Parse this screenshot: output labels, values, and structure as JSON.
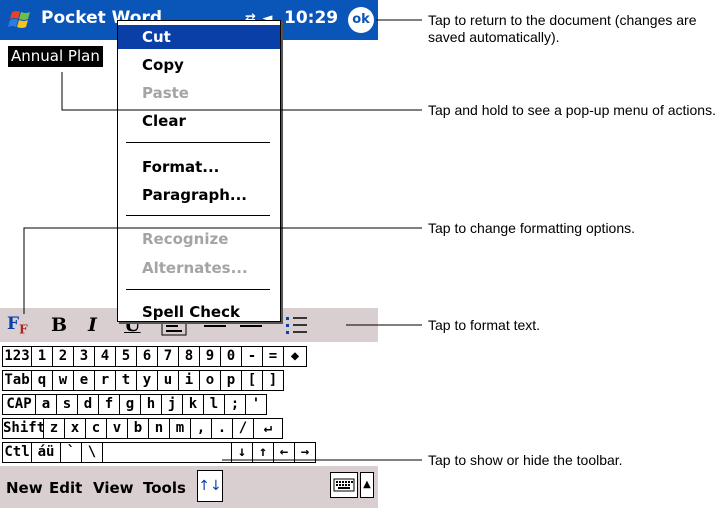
{
  "titlebar": {
    "app_title": "Pocket Word",
    "tray_icons": "⇄ ◄",
    "clock": "10:29",
    "ok_label": "ok"
  },
  "document": {
    "selected_text": "Annual Plan"
  },
  "context_menu": {
    "items": [
      {
        "label": "Cut",
        "state": "selected"
      },
      {
        "label": "Copy",
        "state": "enabled"
      },
      {
        "label": "Paste",
        "state": "disabled"
      },
      {
        "label": "Clear",
        "state": "enabled"
      },
      {
        "label": "Format...",
        "state": "enabled"
      },
      {
        "label": "Paragraph...",
        "state": "enabled"
      },
      {
        "label": "Recognize",
        "state": "disabled"
      },
      {
        "label": "Alternates...",
        "state": "disabled"
      },
      {
        "label": "Spell Check",
        "state": "enabled"
      }
    ]
  },
  "toolbar": {
    "format_icon": "font-format-icon",
    "bold": "B",
    "italic": "I",
    "underline": "U",
    "align_left_icon": "align-left-icon",
    "align_center_icon": "align-center-icon",
    "align_right_icon": "align-right-icon",
    "bullets_icon": "bullets-icon"
  },
  "keyboard": {
    "rows": [
      [
        "123",
        "1",
        "2",
        "3",
        "4",
        "5",
        "6",
        "7",
        "8",
        "9",
        "0",
        "-",
        "=",
        "◆"
      ],
      [
        "Tab",
        "q",
        "w",
        "e",
        "r",
        "t",
        "y",
        "u",
        "i",
        "o",
        "p",
        "[",
        "]"
      ],
      [
        "CAP",
        "a",
        "s",
        "d",
        "f",
        "g",
        "h",
        "j",
        "k",
        "l",
        ";",
        "'"
      ],
      [
        "Shift",
        "z",
        "x",
        "c",
        "v",
        "b",
        "n",
        "m",
        ",",
        ".",
        "/",
        "↵"
      ],
      [
        "Ctl",
        "áü",
        "`",
        "\\",
        " ",
        "↓",
        "↑",
        "←",
        "→"
      ]
    ]
  },
  "menubar": {
    "items": [
      "New",
      "Edit",
      "View",
      "Tools"
    ],
    "toggle_icon": "↑↓",
    "sip_icon": "keyboard-icon",
    "sip_arrow": "▲"
  },
  "callouts": [
    "Tap to return to the document (changes are saved automatically).",
    "Tap and hold to see a pop-up menu of actions.",
    "Tap to change formatting options.",
    "Tap to format text.",
    "Tap to show or hide the toolbar."
  ],
  "colors": {
    "title_bar": "#0a55b8",
    "selection": "#0a3fa8",
    "toolbar": "#d9cfd1",
    "disabled": "#a4a4a4"
  }
}
